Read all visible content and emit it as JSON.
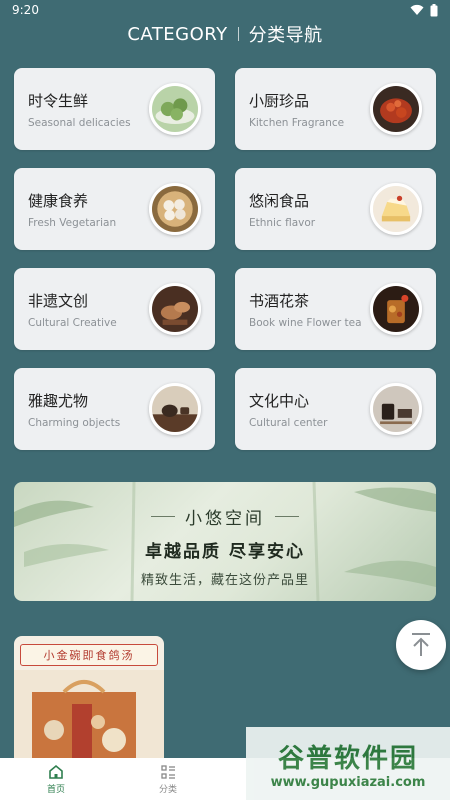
{
  "status": {
    "time": "9:20"
  },
  "header": {
    "title_en": "CATEGORY",
    "title_cn": "分类导航"
  },
  "categories": [
    {
      "title": "时令生鲜",
      "subtitle": "Seasonal delicacies",
      "thumb_icon": "green-buns-photo"
    },
    {
      "title": "小厨珍品",
      "subtitle": "Kitchen Fragrance",
      "thumb_icon": "crayfish-photo"
    },
    {
      "title": "健康食养",
      "subtitle": "Fresh Vegetarian",
      "thumb_icon": "dumplings-photo"
    },
    {
      "title": "悠闲食品",
      "subtitle": "Ethnic flavor",
      "thumb_icon": "cake-photo"
    },
    {
      "title": "非遗文创",
      "subtitle": "Cultural Creative",
      "thumb_icon": "craft-hands-photo"
    },
    {
      "title": "书酒花茶",
      "subtitle": "Book wine Flower tea",
      "thumb_icon": "flower-tea-photo"
    },
    {
      "title": "雅趣尤物",
      "subtitle": "Charming objects",
      "thumb_icon": "tea-set-photo"
    },
    {
      "title": "文化中心",
      "subtitle": "Cultural center",
      "thumb_icon": "stationery-photo"
    }
  ],
  "banner": {
    "line1": "小悠空间",
    "line2": "卓越品质  尽享安心",
    "line3": "精致生活，藏在这份产品里"
  },
  "product": {
    "banner_text": "小金碗即食鸽汤"
  },
  "tabbar": {
    "home_label": "首页",
    "category_label": "分类"
  },
  "watermark": {
    "main": "谷普软件园",
    "url": "www.gupuxiazai.com"
  },
  "colors": {
    "background": "#3f6b73",
    "card": "#eef0f2",
    "active_tab": "#2f7f4f"
  }
}
